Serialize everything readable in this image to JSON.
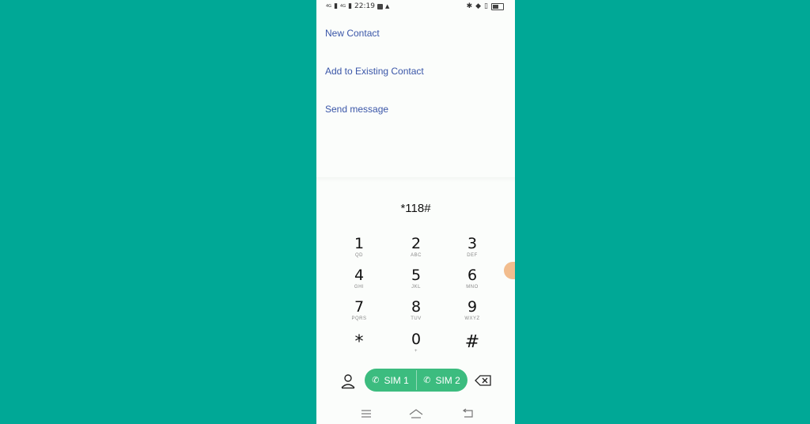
{
  "status_bar": {
    "net1": "4G",
    "net2": "4G",
    "time": "22:19",
    "right_text": "64"
  },
  "menu": {
    "new_contact": "New Contact",
    "add_existing": "Add to Existing Contact",
    "send_message": "Send message"
  },
  "dialed_number": "*118#",
  "keypad": {
    "k1": {
      "digit": "1",
      "letters": "QD"
    },
    "k2": {
      "digit": "2",
      "letters": "ABC"
    },
    "k3": {
      "digit": "3",
      "letters": "DEF"
    },
    "k4": {
      "digit": "4",
      "letters": "GHI"
    },
    "k5": {
      "digit": "5",
      "letters": "JKL"
    },
    "k6": {
      "digit": "6",
      "letters": "MNO"
    },
    "k7": {
      "digit": "7",
      "letters": "PQRS"
    },
    "k8": {
      "digit": "8",
      "letters": "TUV"
    },
    "k9": {
      "digit": "9",
      "letters": "WXYZ"
    },
    "star": "*",
    "k0": {
      "digit": "0",
      "letters": "+"
    },
    "hash": "#"
  },
  "call_buttons": {
    "sim1": "SIM 1",
    "sim2": "SIM 2"
  },
  "colors": {
    "background": "#00a896",
    "accent_green": "#3cbc7f",
    "link_blue": "#3a56a8"
  },
  "icons": [
    "contacts-icon",
    "backspace-icon",
    "phone-icon",
    "menu-icon",
    "home-icon",
    "back-icon"
  ]
}
